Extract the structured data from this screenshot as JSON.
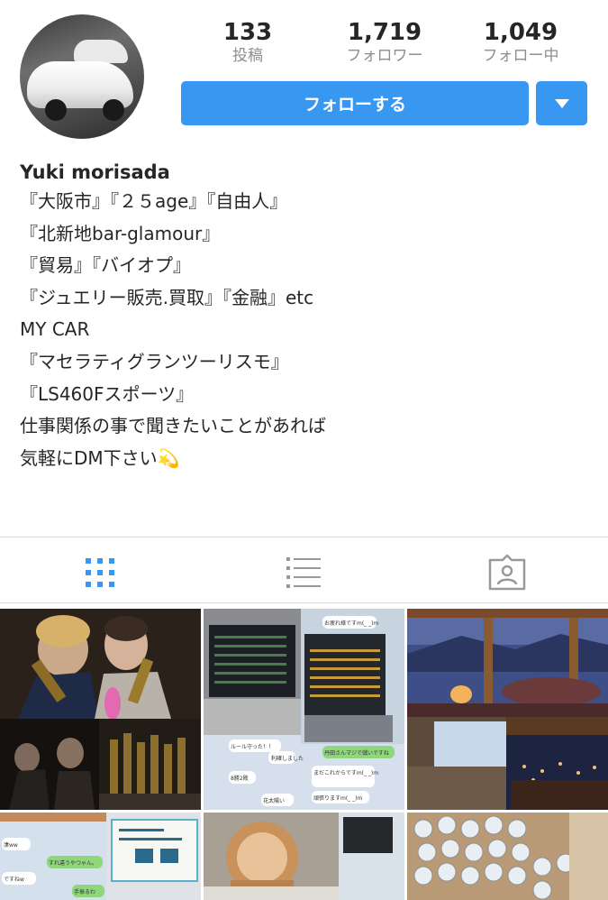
{
  "profile": {
    "username": "Yuki morisada",
    "avatar_icon": "car-photo"
  },
  "stats": [
    {
      "count": "133",
      "label": "投稿"
    },
    {
      "count": "1,719",
      "label": "フォロワー"
    },
    {
      "count": "1,049",
      "label": "フォロー中"
    }
  ],
  "actions": {
    "follow_label": "フォローする",
    "dropdown_icon": "triangle-down-icon"
  },
  "bio": {
    "lines": [
      "『大阪市』『２５age』『自由人』",
      "『北新地bar-glamour』",
      "『貿易』『バイオプ』",
      "『ジュエリー販売.買取』『金融』etc",
      "MY CAR",
      "『マセラティグランツーリスモ』",
      "『LS460Fスポーツ』",
      "仕事関係の事で聞きたいことがあれば",
      "気軽にDM下さい💫"
    ]
  },
  "tabs": [
    {
      "icon": "grid-icon",
      "active": true
    },
    {
      "icon": "list-icon",
      "active": false
    },
    {
      "icon": "tagged-icon",
      "active": false
    }
  ],
  "posts": [
    {
      "id": "post-1",
      "chat_texts": []
    },
    {
      "id": "post-2",
      "chat_texts": [
        "お疲れ様ですm(_ _)m",
        "とりあえず帰ってきて",
        "いえ！",
        "ルール守った！！",
        "利確しました",
        "丹田さんマジで儲いですね",
        "まだこれからですm(_ _)m",
        "頑張りますm(_ _)m",
        "8勝2敗",
        "花太陽い"
      ]
    },
    {
      "id": "post-3",
      "chat_texts": []
    },
    {
      "id": "post-4",
      "chat_texts": [
        "凄ww",
        "ですねw",
        "すれ違うやつゃん。",
        "手振るわ"
      ]
    },
    {
      "id": "post-5",
      "chat_texts": []
    },
    {
      "id": "post-6",
      "chat_texts": []
    }
  ],
  "colors": {
    "accent": "#3897f0",
    "text": "#262626",
    "muted": "#8e8e8e",
    "divider": "#dbdbdb"
  }
}
